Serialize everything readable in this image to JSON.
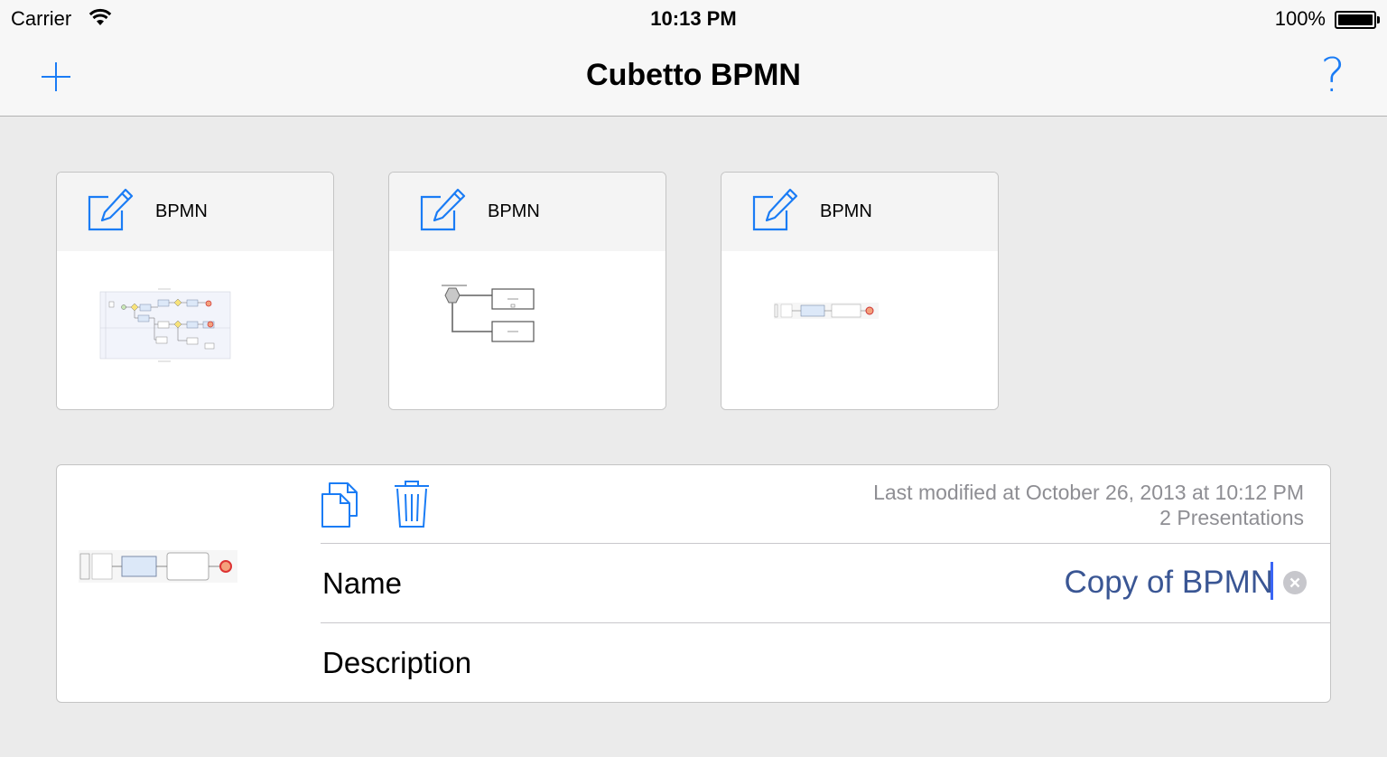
{
  "status_bar": {
    "carrier": "Carrier",
    "time": "10:13 PM",
    "battery": "100%"
  },
  "nav": {
    "title": "Cubetto BPMN",
    "add_icon": "plus-icon",
    "help_icon": "question-mark-icon",
    "help_glyph": "?"
  },
  "documents": [
    {
      "title": "BPMN",
      "thumbnail": "process-diagram"
    },
    {
      "title": "BPMN",
      "thumbnail": "conversation-diagram"
    },
    {
      "title": "BPMN",
      "thumbnail": "simple-activity-diagram"
    }
  ],
  "detail": {
    "last_modified": "Last modified at October 26, 2013 at 10:12 PM",
    "presentations": "2 Presentations",
    "name_label": "Name",
    "name_value": "Copy of BPMN",
    "description_label": "Description",
    "description_value": "",
    "copy_icon": "duplicate-icon",
    "trash_icon": "trash-icon",
    "clear_icon": "clear-circle-icon"
  },
  "colors": {
    "accent": "#1a7cf5",
    "input_text": "#3a5694",
    "meta_text": "#8e8e93"
  }
}
